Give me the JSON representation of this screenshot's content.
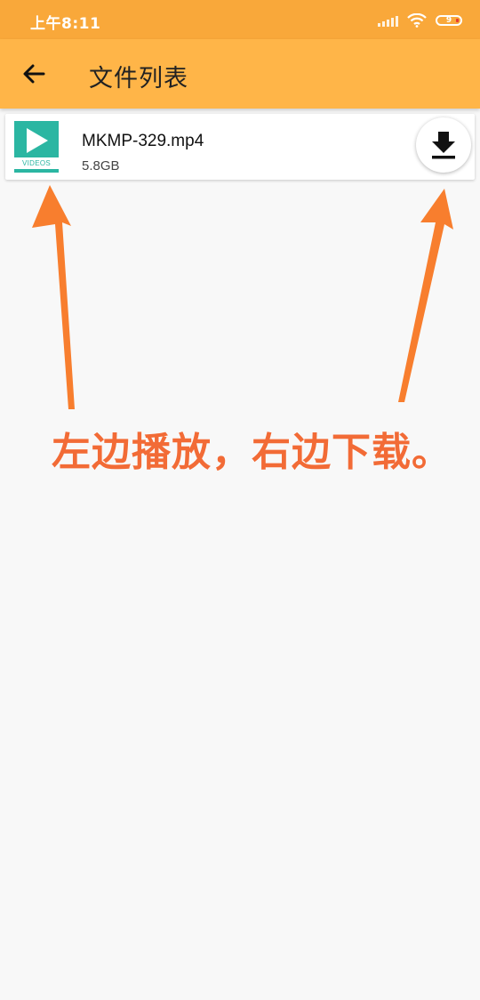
{
  "status_bar": {
    "time": "上午8:11",
    "battery": "9"
  },
  "app_bar": {
    "title": "文件列表"
  },
  "files": [
    {
      "thumb_label": "VIDEOS",
      "name": "MKMP-329.mp4",
      "size": "5.8GB"
    }
  ],
  "annotation": {
    "text": "左边播放，右边下载。",
    "color": "#f26b36"
  },
  "colors": {
    "status_bar": "#f9a83a",
    "app_bar": "#ffb548",
    "thumb": "#2bb6a2"
  }
}
